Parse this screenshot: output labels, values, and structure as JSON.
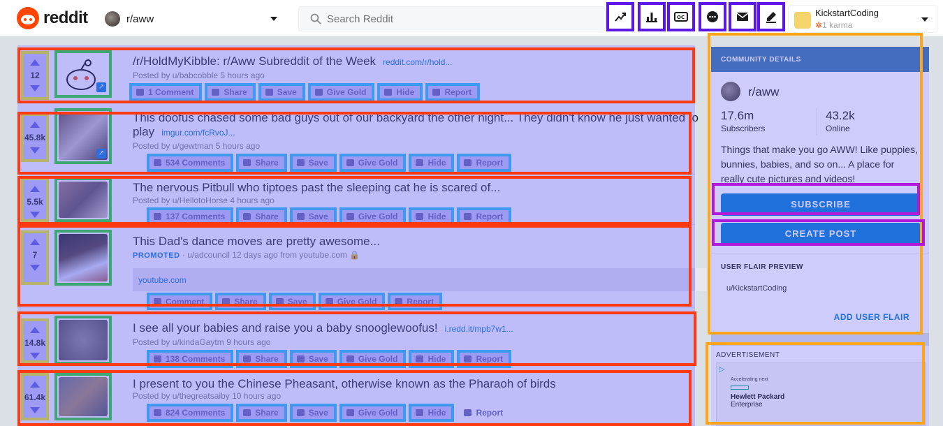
{
  "header": {
    "logo_text": "reddit",
    "subreddit": "r/aww",
    "search_placeholder": "Search Reddit",
    "icons": [
      "trending-icon",
      "stats-icon",
      "captions-icon",
      "chat-icon",
      "mail-icon",
      "pencil-icon"
    ],
    "user": {
      "name": "KickstartCoding",
      "karma": "1 karma"
    }
  },
  "posts": [
    {
      "score": "12",
      "title": "/r/HoldMyKibble: r/Aww Subreddit of the Week",
      "link": "reddit.com/r/hold...",
      "meta": "Posted by u/babcobble 5 hours ago",
      "comments": "1 Comment"
    },
    {
      "score": "45.8k",
      "title": "This doofus chased some bad guys out of our backyard the other night... They didn't know he just wanted to",
      "title2": "play",
      "link": "imgur.com/fcRvoJ...",
      "meta": "Posted by u/gewtman 5 hours ago",
      "comments": "534 Comments"
    },
    {
      "score": "5.5k",
      "title": "The nervous Pitbull who tiptoes past the sleeping cat he is scared of...",
      "link": "",
      "meta": "Posted by u/HellotoHorse 4 hours ago",
      "comments": "137 Comments"
    },
    {
      "score": "7",
      "title": "This Dad's dance moves are pretty awesome...",
      "promoted": "PROMOTED",
      "meta": "· u/adcouncil 12 days ago from youtube.com",
      "promo_link": "youtube.com",
      "comments": "Comment"
    },
    {
      "score": "14.8k",
      "title": "I see all your babies and raise you a baby snooglewoofus!",
      "link": "i.redd.it/mpb7w1...",
      "meta": "Posted by u/kindaGaytm 9 hours ago",
      "comments": "138 Comments"
    },
    {
      "score": "61.4k",
      "title": "I present to you the Chinese Pheasant, otherwise known as the Pharaoh of birds",
      "link": "",
      "meta": "Posted by u/thegreatsaiby 10 hours ago",
      "comments": "824 Comments"
    }
  ],
  "post_actions": {
    "share": "Share",
    "save": "Save",
    "give_gold": "Give Gold",
    "hide": "Hide",
    "report": "Report"
  },
  "community": {
    "header": "COMMUNITY DETAILS",
    "name": "r/aww",
    "subscribers": "17.6m",
    "subscribers_label": "Subscribers",
    "online": "43.2k",
    "online_label": "Online",
    "description": "Things that make you go AWW! Like puppies, bunnies, babies, and so on... A place for really cute pictures and videos!",
    "subscribe_button": "SUBSCRIBE",
    "create_post_button": "CREATE POST",
    "flair_header": "USER FLAIR PREVIEW",
    "flair_user": "u/KickstartCoding",
    "add_flair": "ADD USER FLAIR"
  },
  "ad": {
    "label": "ADVERTISEMENT",
    "tagline": "Accelerating next",
    "brand": "Hewlett Packard",
    "brand2": "Enterprise"
  },
  "colors": {
    "accent": "#0079d3",
    "brand": "#ff4500",
    "community_header": "#3674a8"
  }
}
